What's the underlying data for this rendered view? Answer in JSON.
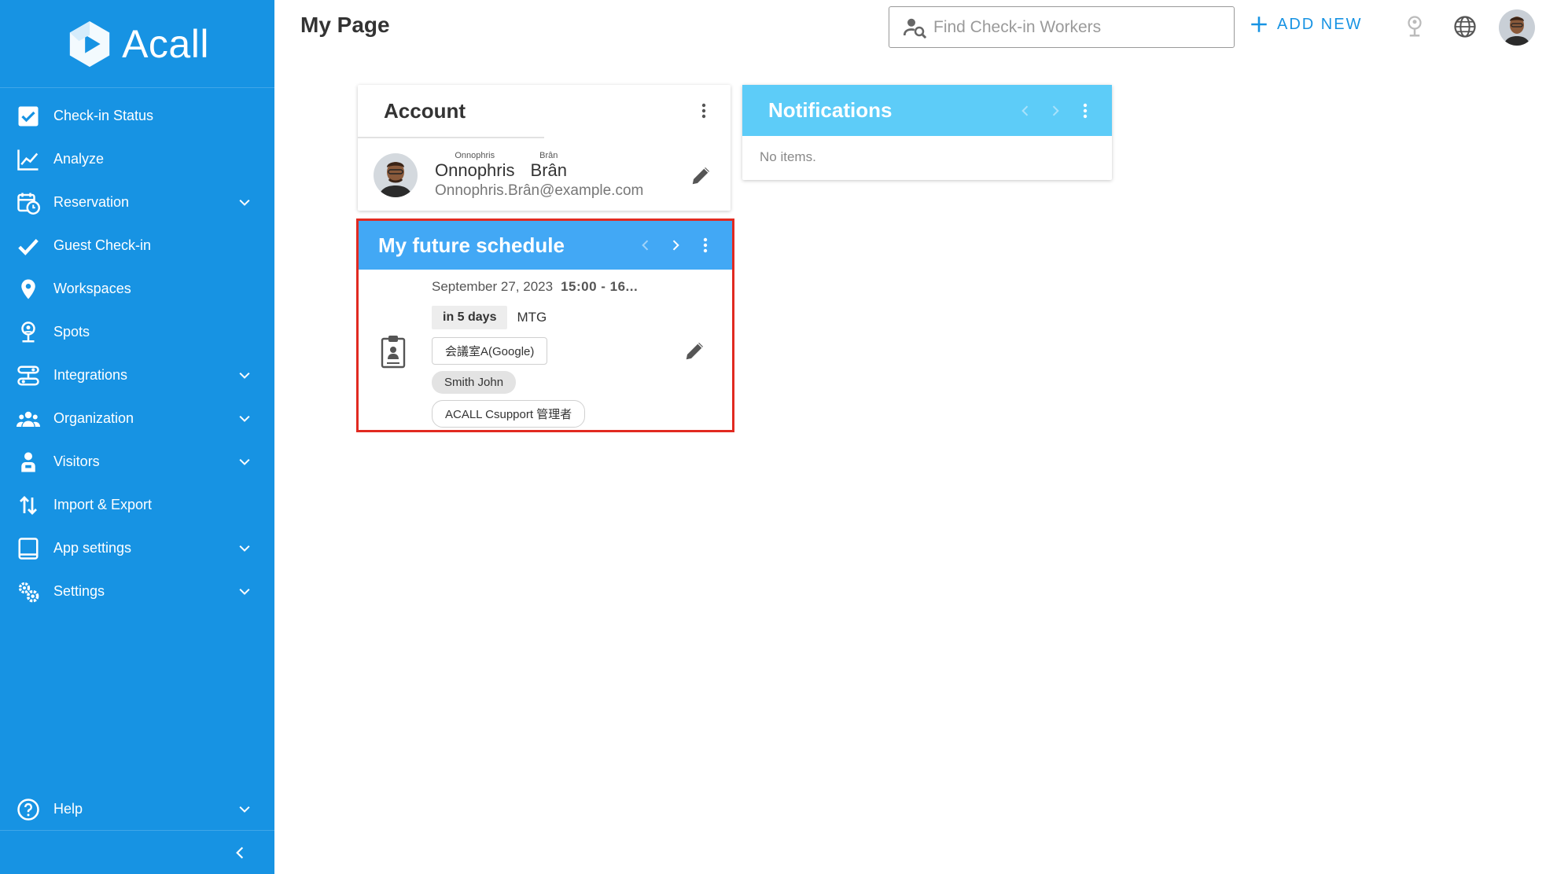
{
  "brand": {
    "name": "Acall",
    "sidebar_color": "#1793e3",
    "accent_color": "#1793e3",
    "highlight_color": "#e12a21"
  },
  "sidebar": {
    "items": [
      {
        "label": "Check-in Status",
        "icon": "checkbox-icon",
        "expandable": false
      },
      {
        "label": "Analyze",
        "icon": "line-chart-icon",
        "expandable": false
      },
      {
        "label": "Reservation",
        "icon": "calendar-clock-icon",
        "expandable": true
      },
      {
        "label": "Guest Check-in",
        "icon": "checkmark-icon",
        "expandable": false
      },
      {
        "label": "Workspaces",
        "icon": "map-pin-icon",
        "expandable": false
      },
      {
        "label": "Spots",
        "icon": "person-pin-icon",
        "expandable": false
      },
      {
        "label": "Integrations",
        "icon": "integrations-icon",
        "expandable": true
      },
      {
        "label": "Organization",
        "icon": "group-icon",
        "expandable": true
      },
      {
        "label": "Visitors",
        "icon": "visitor-icon",
        "expandable": true
      },
      {
        "label": "Import & Export",
        "icon": "import-export-icon",
        "expandable": false
      },
      {
        "label": "App settings",
        "icon": "tablet-icon",
        "expandable": true
      },
      {
        "label": "Settings",
        "icon": "gears-icon",
        "expandable": true
      }
    ],
    "help": {
      "label": "Help",
      "icon": "help-circle-icon"
    }
  },
  "header": {
    "title": "My Page",
    "search_placeholder": "Find Check-in Workers",
    "add_new_label": "ADD NEW"
  },
  "account": {
    "title": "Account",
    "first_name": "Onnophris",
    "first_name_ruby": "Onnophris",
    "last_name": "Brân",
    "last_name_ruby": "Brân",
    "email": "Onnophris.Brân@example.com"
  },
  "notifications": {
    "title": "Notifications",
    "empty_text": "No items."
  },
  "schedule": {
    "title": "My future schedule",
    "date": "September 27, 2023",
    "time": "15:00 - 16...",
    "relative": "in 5 days",
    "event_title": "MTG",
    "location": "会議室A(Google)",
    "attendees": [
      "Smith John",
      "ACALL Csupport 管理者"
    ]
  }
}
